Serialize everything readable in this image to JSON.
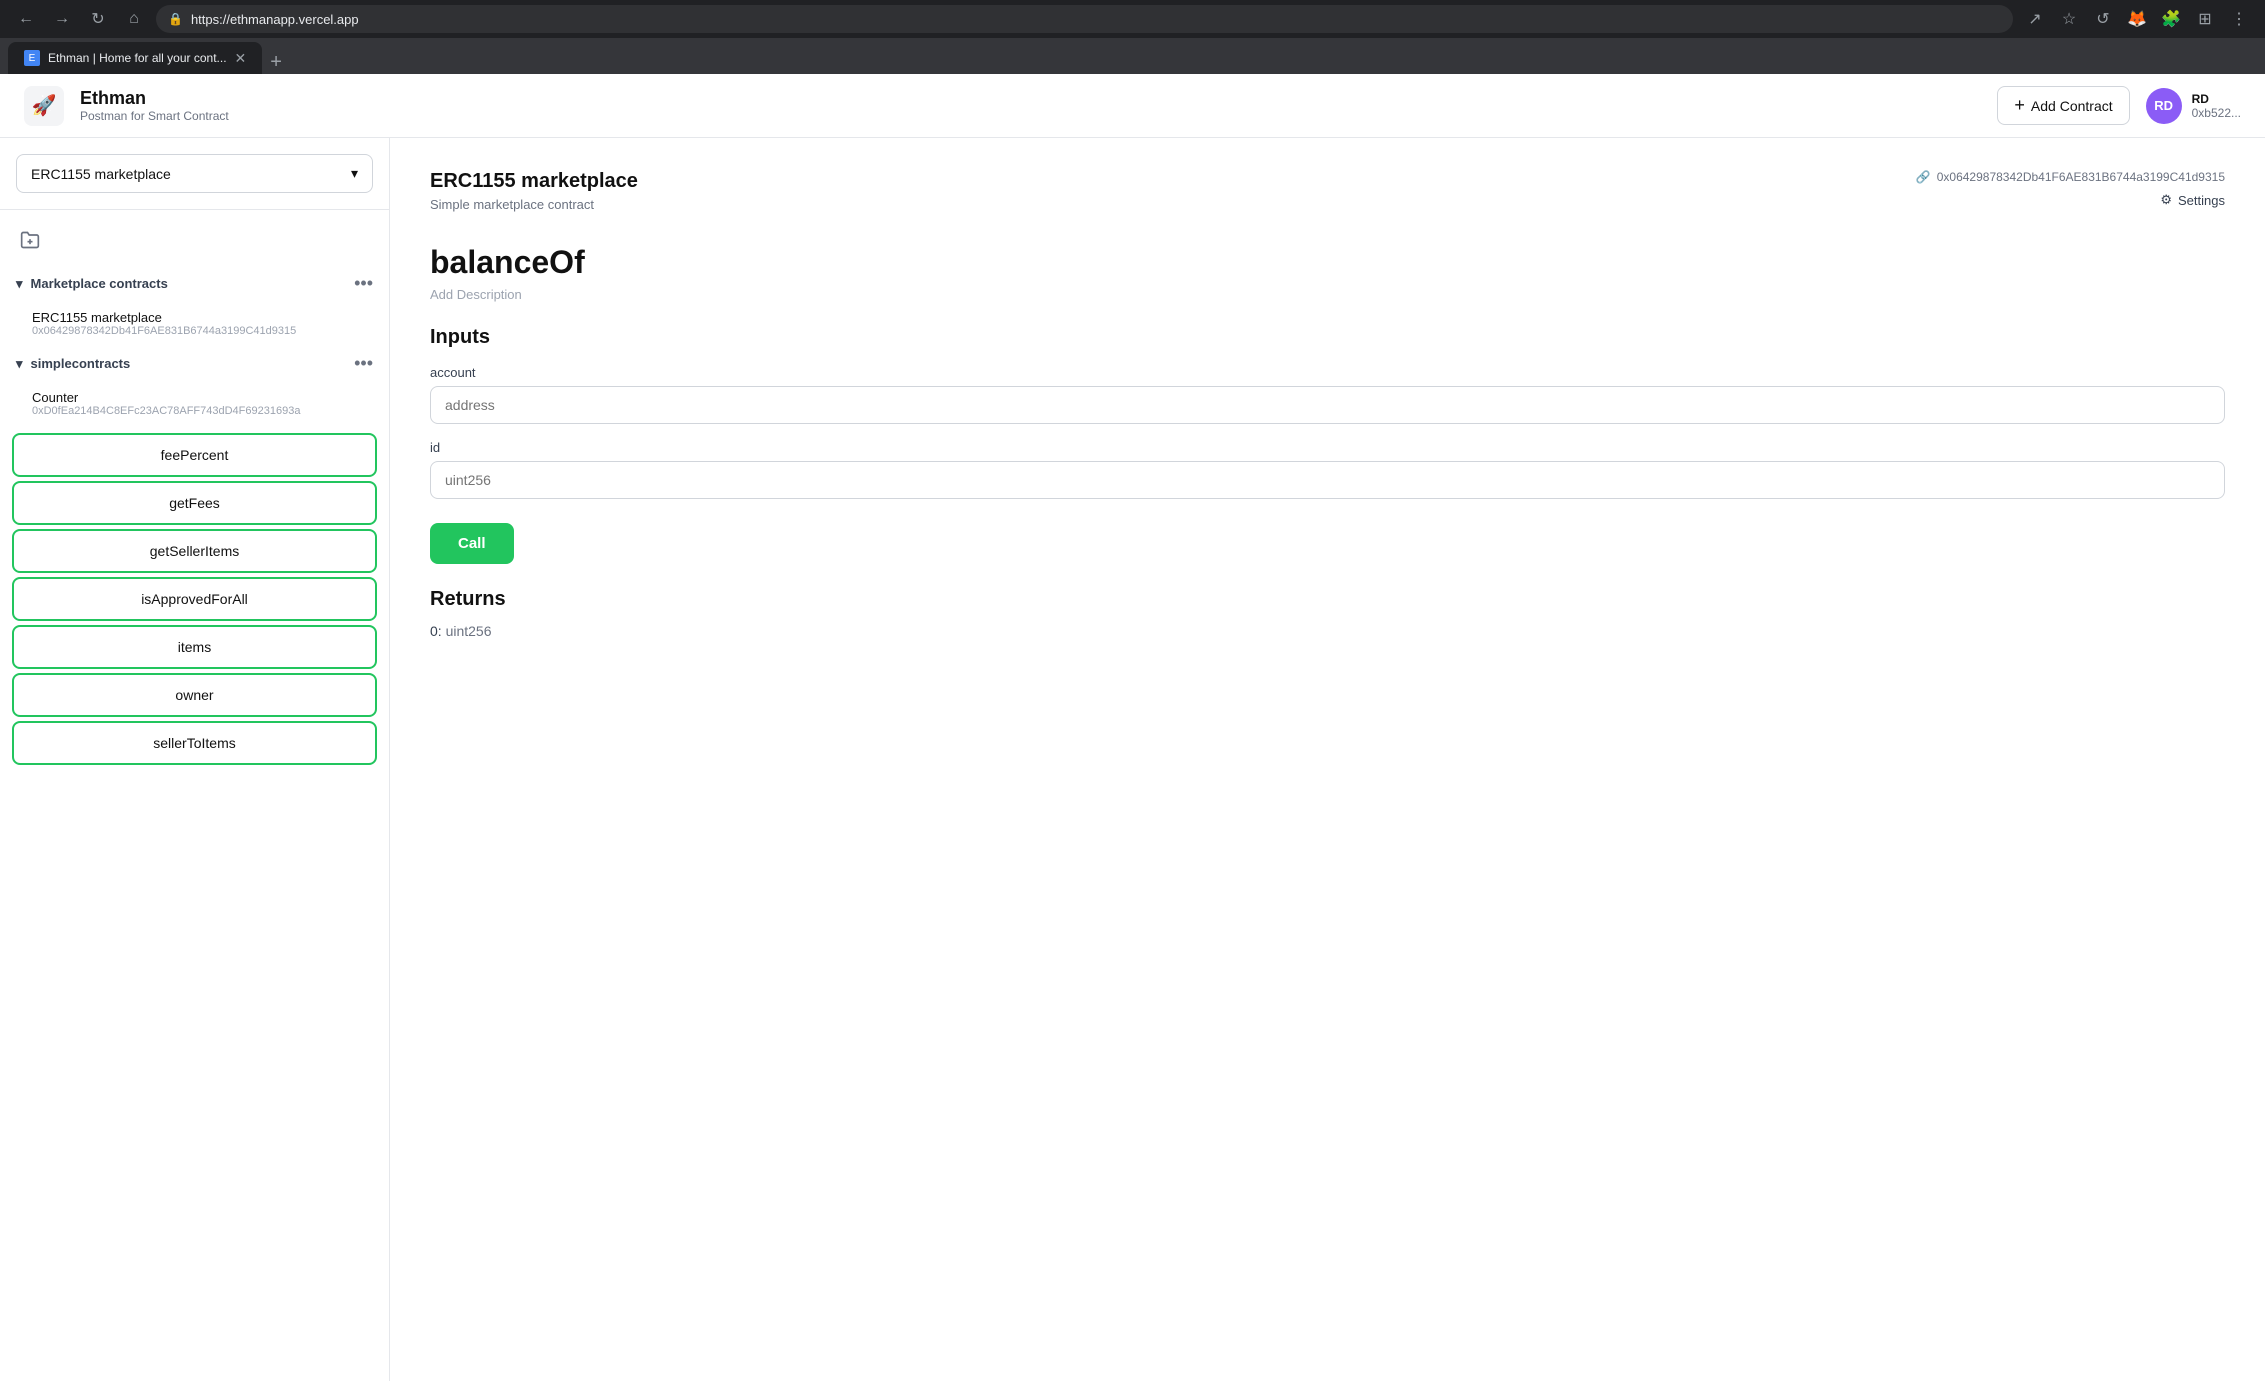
{
  "browser": {
    "tab_title": "Ethman | Home for all your cont...",
    "url": "https://ethmanapp.vercel.app",
    "new_tab_label": "+"
  },
  "header": {
    "logo_icon": "🚀",
    "app_name": "Ethman",
    "app_tagline": "Postman for Smart Contract",
    "add_contract_label": "Add Contract",
    "user": {
      "name": "RD",
      "address": "0xb522..."
    }
  },
  "sidebar": {
    "selected_collection": "ERC1155 marketplace",
    "dropdown_icon": "▾",
    "sections": [
      {
        "id": "marketplace",
        "title": "Marketplace contracts",
        "contracts": [
          {
            "name": "ERC1155 marketplace",
            "address": "0x06429878342Db41F6AE831B6744a3199C41d9315"
          }
        ]
      },
      {
        "id": "simple",
        "title": "simplecontracts",
        "contracts": [
          {
            "name": "Counter",
            "address": "0xD0fEa214B4C8EFc23AC78AFF743dD4F69231693a"
          }
        ]
      }
    ],
    "functions": [
      {
        "id": "feePercent",
        "label": "feePercent"
      },
      {
        "id": "getFees",
        "label": "getFees"
      },
      {
        "id": "getSellerItems",
        "label": "getSellerItems"
      },
      {
        "id": "isApprovedForAll",
        "label": "isApprovedForAll"
      },
      {
        "id": "items",
        "label": "items"
      },
      {
        "id": "owner",
        "label": "owner"
      },
      {
        "id": "sellerToItems",
        "label": "sellerToItems"
      }
    ]
  },
  "main": {
    "contract_name": "ERC1155 marketplace",
    "contract_description": "Simple marketplace contract",
    "contract_address": "0x06429878342Db41F6AE831B6744a3199C41d9315",
    "settings_label": "Settings",
    "function": {
      "name": "balanceOf",
      "description": "Add Description",
      "inputs_label": "Inputs",
      "inputs": [
        {
          "id": "account",
          "label": "account",
          "placeholder": "address"
        },
        {
          "id": "id",
          "label": "id",
          "placeholder": "uint256"
        }
      ],
      "call_label": "Call",
      "returns_label": "Returns",
      "returns": [
        {
          "index": "0",
          "type": "uint256"
        }
      ]
    }
  }
}
